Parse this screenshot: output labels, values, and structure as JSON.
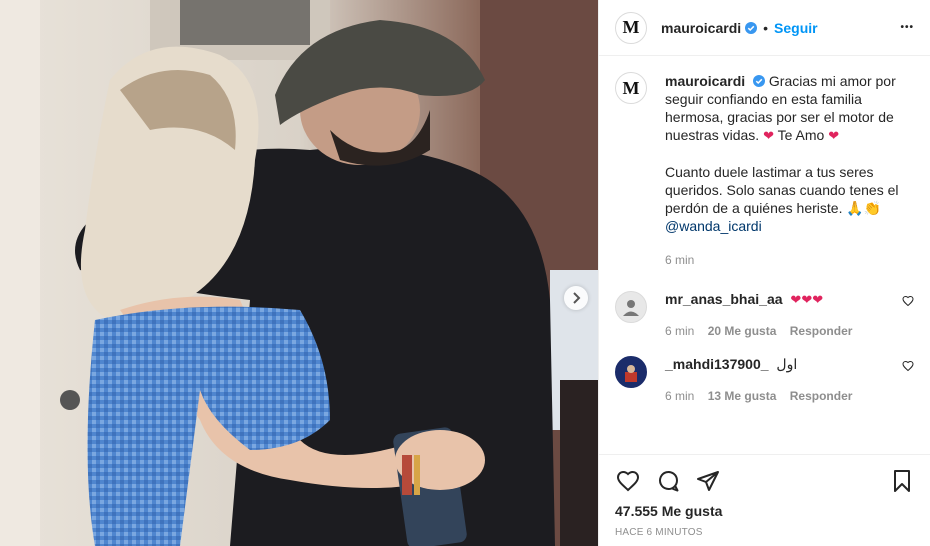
{
  "post": {
    "username": "mauroicardi",
    "follow_label": "Seguir",
    "separator": "•",
    "logo_text": "M",
    "more_label": "•••"
  },
  "caption": {
    "username": "mauroicardi",
    "line1": "Gracias mi amor por seguir confiando en esta familia hermosa, gracias por ser el motor de nuestras vidas.",
    "line1_tail": "Te Amo",
    "line2": "Cuanto duele lastimar a tus seres queridos. Solo sanas cuando tenes el perdón de a quiénes heriste.",
    "mention": "@wanda_icardi",
    "time": "6 min"
  },
  "comments": [
    {
      "username": "mr_anas_bhai_aa",
      "text": "",
      "time": "6 min",
      "likes": "20 Me gusta",
      "reply": "Responder"
    },
    {
      "username": "_mahdi137900_",
      "text": "اول",
      "time": "6 min",
      "likes": "13 Me gusta",
      "reply": "Responder"
    }
  ],
  "footer": {
    "likes": "47.555 Me gusta",
    "ago": "HACE 6 MINUTOS"
  },
  "colors": {
    "accent": "#0095f6",
    "heart": "#e0245e",
    "verified": "#3897f0"
  }
}
